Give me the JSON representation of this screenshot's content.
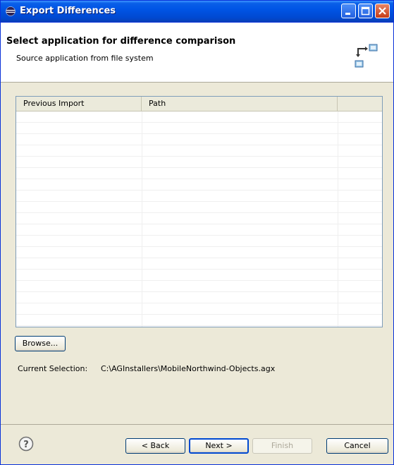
{
  "window": {
    "title": "Export Differences"
  },
  "header": {
    "title": "Select application for difference comparison",
    "subtitle": "Source application from file system"
  },
  "table": {
    "columns": [
      "Previous Import",
      "Path",
      ""
    ],
    "rows": []
  },
  "actions": {
    "browse_label": "Browse..."
  },
  "selection": {
    "label": "Current Selection:",
    "value": "C:\\AGInstallers\\MobileNorthwind-Objects.agx"
  },
  "buttons": {
    "back": "< Back",
    "next": "Next >",
    "finish": "Finish",
    "cancel": "Cancel"
  },
  "icons": {
    "title": "eclipse-icon",
    "header": "compare-icon",
    "help": "help-icon"
  },
  "colors": {
    "titlebar": "#0055e5",
    "dialog_bg": "#ece9d8",
    "default_button_border": "#0049d1"
  }
}
